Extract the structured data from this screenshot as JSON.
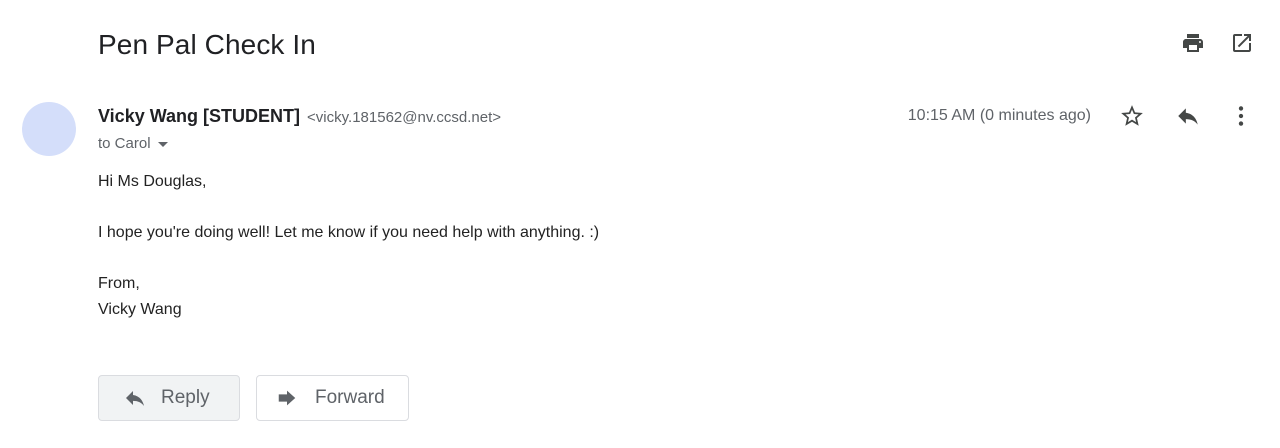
{
  "email": {
    "subject": "Pen Pal Check In",
    "sender": {
      "name": "Vicky Wang [STUDENT]",
      "email": "<vicky.181562@nv.ccsd.net>",
      "avatar_color": "#d4defa"
    },
    "to_line": "to Carol",
    "timestamp": "10:15 AM (0 minutes ago)",
    "body": {
      "greeting": "Hi Ms Douglas,",
      "message": "I hope you're doing well! Let me know if you need help with anything. :)",
      "closing": "From,",
      "signature": "Vicky Wang"
    }
  },
  "toolbar": {
    "print_icon": "print-icon",
    "popout_icon": "open-in-new-window-icon"
  },
  "header_actions": {
    "star_icon": "star-icon",
    "reply_icon": "reply-icon",
    "more_icon": "more-vertical-icon"
  },
  "actions": {
    "reply_label": "Reply",
    "forward_label": "Forward"
  },
  "colors": {
    "icon_dark": "#444746",
    "text_secondary": "#5f6368",
    "reply_button_bg": "#f1f3f4"
  }
}
